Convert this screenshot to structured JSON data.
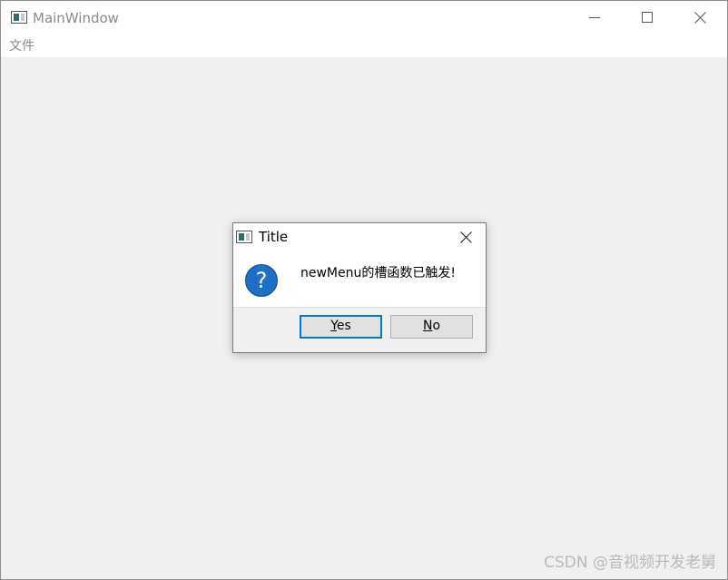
{
  "main_window": {
    "title": "MainWindow",
    "app_icon": "window-icon",
    "controls": {
      "minimize_icon": "minimize-icon",
      "maximize_icon": "maximize-icon",
      "close_icon": "close-icon"
    }
  },
  "menubar": {
    "items": [
      {
        "label": "文件"
      }
    ]
  },
  "dialog": {
    "title": "Title",
    "icon": "window-icon",
    "close_icon": "close-icon",
    "message_icon": "question-icon",
    "message_icon_glyph": "?",
    "message": "newMenu的槽函数已触发!",
    "buttons": [
      {
        "mnemonic": "Y",
        "rest": "es",
        "default": true
      },
      {
        "mnemonic": "N",
        "rest": "o",
        "default": false
      }
    ]
  },
  "watermark": "CSDN @音视频开发老舅",
  "colors": {
    "accent": "#0078d7",
    "question_icon": "#1f6fc7"
  }
}
